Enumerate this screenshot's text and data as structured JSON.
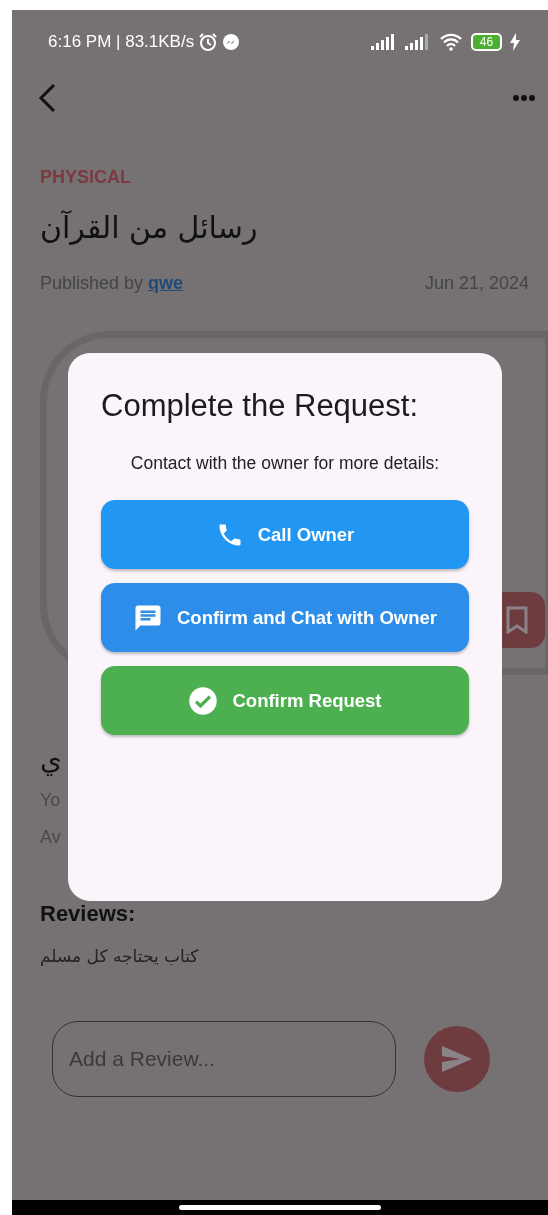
{
  "status_bar": {
    "time": "6:16 PM | 83.1KB/s",
    "battery": "46"
  },
  "post": {
    "category": "PHYSICAL",
    "title": "رسائل من القرآن",
    "published_by": "Published by",
    "author": "qwe",
    "date": "Jun 21, 2024"
  },
  "details": {
    "heading": "ي",
    "lines": [
      "Yo",
      "Av"
    ]
  },
  "reviews": {
    "heading": "Reviews:",
    "items": [
      {
        "text": "كتاب يحتاجه كل مسلم"
      }
    ],
    "input": {
      "placeholder": "Add a Review..."
    }
  },
  "dialog": {
    "title": "Complete the Request:",
    "subtitle": "Contact with the owner for more details:",
    "buttons": [
      {
        "label": "Call Owner",
        "kind": "call"
      },
      {
        "label": "Confirm and Chat with Owner",
        "kind": "chat"
      },
      {
        "label": "Confirm Request",
        "kind": "confirm"
      }
    ]
  }
}
